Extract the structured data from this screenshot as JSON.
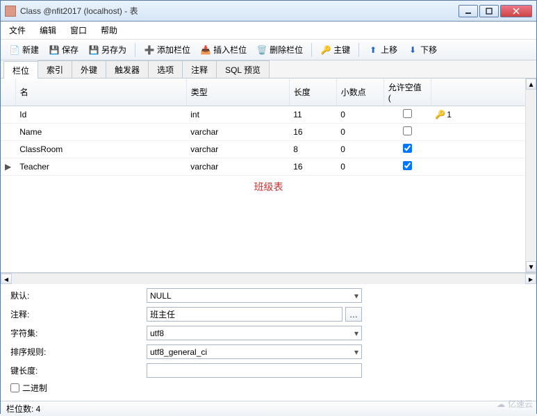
{
  "window": {
    "title": "Class @nfit2017 (localhost) - 表"
  },
  "menu": {
    "file": "文件",
    "edit": "编辑",
    "window": "窗口",
    "help": "帮助"
  },
  "toolbar": {
    "new": "新建",
    "save": "保存",
    "saveas": "另存为",
    "addcol": "添加栏位",
    "inscol": "插入栏位",
    "delcol": "删除栏位",
    "pkey": "主键",
    "moveup": "上移",
    "movedown": "下移"
  },
  "tabs": {
    "fields": "栏位",
    "index": "索引",
    "fk": "外键",
    "trigger": "触发器",
    "options": "选项",
    "comment": "注释",
    "sql": "SQL 预览"
  },
  "grid": {
    "headers": {
      "name": "名",
      "type": "类型",
      "len": "长度",
      "dec": "小数点",
      "null": "允许空值 (",
      "key": ""
    },
    "rows": [
      {
        "mark": "",
        "name": "Id",
        "type": "int",
        "len": "11",
        "dec": "0",
        "null": false,
        "key": "1"
      },
      {
        "mark": "",
        "name": "Name",
        "type": "varchar",
        "len": "16",
        "dec": "0",
        "null": false,
        "key": ""
      },
      {
        "mark": "",
        "name": "ClassRoom",
        "type": "varchar",
        "len": "8",
        "dec": "0",
        "null": true,
        "key": ""
      },
      {
        "mark": "▶",
        "name": "Teacher",
        "type": "varchar",
        "len": "16",
        "dec": "0",
        "null": true,
        "key": ""
      }
    ]
  },
  "annotation": "班级表",
  "props": {
    "default_label": "默认:",
    "default_value": "NULL",
    "comment_label": "注释:",
    "comment_value": "班主任",
    "charset_label": "字符集:",
    "charset_value": "utf8",
    "collate_label": "排序规则:",
    "collate_value": "utf8_general_ci",
    "keylen_label": "键长度:",
    "keylen_value": "",
    "binary_label": "二进制"
  },
  "status": {
    "text": "栏位数: 4"
  },
  "watermark": "亿速云"
}
